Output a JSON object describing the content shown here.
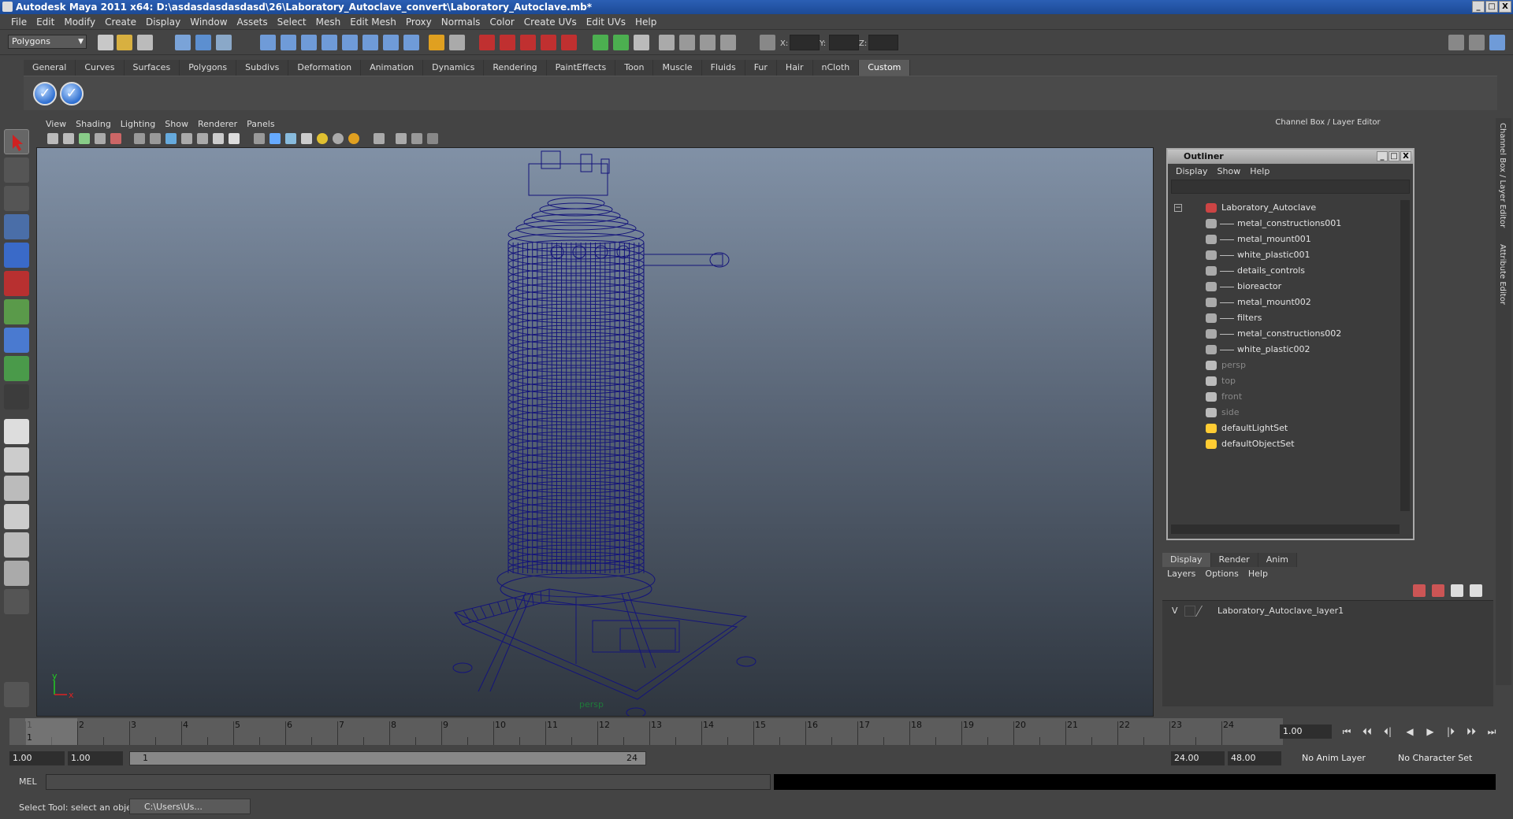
{
  "window": {
    "title": "Autodesk Maya 2011 x64: D:\\asdasdasdasdasd\\26\\Laboratory_Autoclave_convert\\Laboratory_Autoclave.mb*",
    "min": "_",
    "max": "□",
    "close": "X"
  },
  "menubar": [
    "File",
    "Edit",
    "Modify",
    "Create",
    "Display",
    "Window",
    "Assets",
    "Select",
    "Mesh",
    "Edit Mesh",
    "Proxy",
    "Normals",
    "Color",
    "Create UVs",
    "Edit UVs",
    "Help"
  ],
  "statusline": {
    "mode": "Polygons",
    "x_label": "X:",
    "y_label": "Y:",
    "z_label": "Z:"
  },
  "shelf": {
    "tabs": [
      "General",
      "Curves",
      "Surfaces",
      "Polygons",
      "Subdivs",
      "Deformation",
      "Animation",
      "Dynamics",
      "Rendering",
      "PaintEffects",
      "Toon",
      "Muscle",
      "Fluids",
      "Fur",
      "Hair",
      "nCloth",
      "Custom"
    ],
    "active_tab": "Custom"
  },
  "viewport": {
    "menu": [
      "View",
      "Shading",
      "Lighting",
      "Show",
      "Renderer",
      "Panels"
    ],
    "camera": "persp",
    "axis_x": "x",
    "axis_y": "y",
    "wire_color": "#14147a"
  },
  "channel_box_title": "Channel Box / Layer Editor",
  "side_tabs": [
    "Channel Box / Layer Editor",
    "Attribute Editor"
  ],
  "outliner": {
    "title": "Outliner",
    "menu": [
      "Display",
      "Show",
      "Help"
    ],
    "items": [
      {
        "label": "Laboratory_Autoclave",
        "level": 0,
        "type": "group",
        "dim": false
      },
      {
        "label": "metal_constructions001",
        "level": 1,
        "type": "mesh",
        "dim": false
      },
      {
        "label": "metal_mount001",
        "level": 1,
        "type": "mesh",
        "dim": false
      },
      {
        "label": "white_plastic001",
        "level": 1,
        "type": "mesh",
        "dim": false
      },
      {
        "label": "details_controls",
        "level": 1,
        "type": "mesh",
        "dim": false
      },
      {
        "label": "bioreactor",
        "level": 1,
        "type": "mesh",
        "dim": false
      },
      {
        "label": "metal_mount002",
        "level": 1,
        "type": "mesh",
        "dim": false
      },
      {
        "label": "filters",
        "level": 1,
        "type": "mesh",
        "dim": false
      },
      {
        "label": "metal_constructions002",
        "level": 1,
        "type": "mesh",
        "dim": false
      },
      {
        "label": "white_plastic002",
        "level": 1,
        "type": "mesh",
        "dim": false
      },
      {
        "label": "persp",
        "level": 0,
        "type": "camera",
        "dim": true
      },
      {
        "label": "top",
        "level": 0,
        "type": "camera",
        "dim": true
      },
      {
        "label": "front",
        "level": 0,
        "type": "camera",
        "dim": true
      },
      {
        "label": "side",
        "level": 0,
        "type": "camera",
        "dim": true
      },
      {
        "label": "defaultLightSet",
        "level": 0,
        "type": "set",
        "dim": false
      },
      {
        "label": "defaultObjectSet",
        "level": 0,
        "type": "set",
        "dim": false
      }
    ]
  },
  "layer_editor": {
    "tabs": [
      "Display",
      "Render",
      "Anim"
    ],
    "active_tab": "Display",
    "menu": [
      "Layers",
      "Options",
      "Help"
    ],
    "layers": [
      {
        "visible": "V",
        "name": "Laboratory_Autoclave_layer1"
      }
    ]
  },
  "timeline": {
    "ticks": [
      "1",
      "2",
      "3",
      "4",
      "5",
      "6",
      "7",
      "8",
      "9",
      "10",
      "11",
      "12",
      "13",
      "14",
      "15",
      "16",
      "17",
      "18",
      "19",
      "20",
      "21",
      "22",
      "23",
      "24"
    ],
    "current_frame_marker": "1",
    "current_time": "1.00"
  },
  "range": {
    "start_time": "1.00",
    "playback_start": "1.00",
    "slider_start": "1",
    "slider_end": "24",
    "playback_end": "24.00",
    "end_time": "48.00",
    "anim_layer": "No Anim Layer",
    "character_set": "No Character Set"
  },
  "command_line": {
    "language": "MEL"
  },
  "help_line": {
    "text": "Select Tool: select an object",
    "taskbar_item": "C:\\Users\\Us..."
  }
}
